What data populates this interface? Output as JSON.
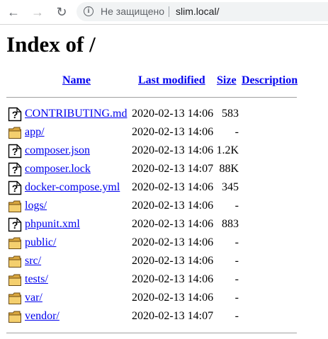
{
  "browser": {
    "security_label": "Не защищено",
    "url": "slim.local/"
  },
  "page": {
    "title": "Index of /",
    "columns": {
      "name": "Name",
      "last_modified": "Last modified",
      "size": "Size",
      "description": "Description"
    },
    "rows": [
      {
        "name": "CONTRIBUTING.md",
        "date": "2020-02-13 14:06",
        "size": "583",
        "icon": "file-unknown-icon"
      },
      {
        "name": "app/",
        "date": "2020-02-13 14:06",
        "size": "-",
        "icon": "folder-icon"
      },
      {
        "name": "composer.json",
        "date": "2020-02-13 14:06",
        "size": "1.2K",
        "icon": "file-unknown-icon"
      },
      {
        "name": "composer.lock",
        "date": "2020-02-13 14:07",
        "size": "88K",
        "icon": "file-unknown-icon"
      },
      {
        "name": "docker-compose.yml",
        "date": "2020-02-13 14:06",
        "size": "345",
        "icon": "file-unknown-icon"
      },
      {
        "name": "logs/",
        "date": "2020-02-13 14:06",
        "size": "-",
        "icon": "folder-icon"
      },
      {
        "name": "phpunit.xml",
        "date": "2020-02-13 14:06",
        "size": "883",
        "icon": "file-unknown-icon"
      },
      {
        "name": "public/",
        "date": "2020-02-13 14:06",
        "size": "-",
        "icon": "folder-icon"
      },
      {
        "name": "src/",
        "date": "2020-02-13 14:06",
        "size": "-",
        "icon": "folder-icon"
      },
      {
        "name": "tests/",
        "date": "2020-02-13 14:06",
        "size": "-",
        "icon": "folder-icon"
      },
      {
        "name": "var/",
        "date": "2020-02-13 14:06",
        "size": "-",
        "icon": "folder-icon"
      },
      {
        "name": "vendor/",
        "date": "2020-02-13 14:07",
        "size": "-",
        "icon": "folder-icon"
      }
    ]
  }
}
